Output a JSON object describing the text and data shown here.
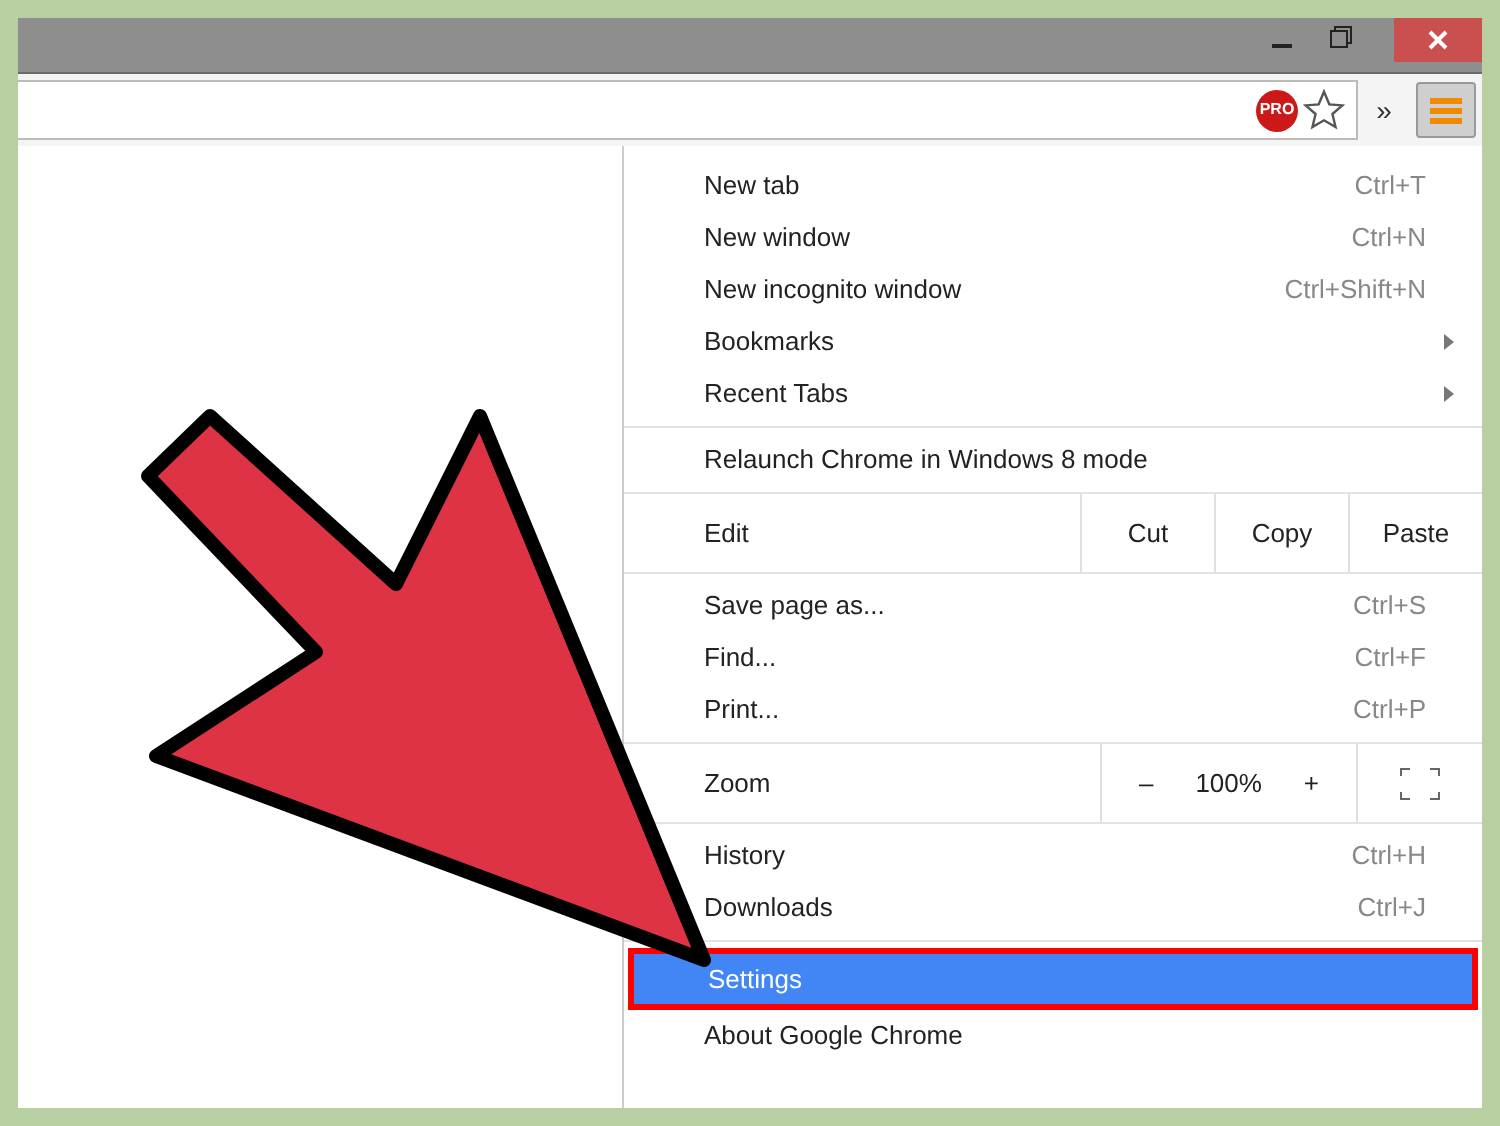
{
  "toolbar": {
    "badge": "PRO",
    "overflow": "»"
  },
  "menu": {
    "sections": [
      {
        "kind": "items",
        "items": [
          {
            "label": "New tab",
            "shortcut": "Ctrl+T",
            "submenu": false,
            "selected": false
          },
          {
            "label": "New window",
            "shortcut": "Ctrl+N",
            "submenu": false,
            "selected": false
          },
          {
            "label": "New incognito window",
            "shortcut": "Ctrl+Shift+N",
            "submenu": false,
            "selected": false
          },
          {
            "label": "Bookmarks",
            "submenu": true,
            "selected": false
          },
          {
            "label": "Recent Tabs",
            "submenu": true,
            "selected": false
          }
        ]
      },
      {
        "kind": "items",
        "items": [
          {
            "label": "Relaunch Chrome in Windows 8 mode",
            "submenu": false,
            "selected": false
          }
        ]
      },
      {
        "kind": "edit",
        "label": "Edit",
        "buttons": [
          "Cut",
          "Copy",
          "Paste"
        ]
      },
      {
        "kind": "items",
        "items": [
          {
            "label": "Save page as...",
            "shortcut": "Ctrl+S",
            "submenu": false,
            "selected": false
          },
          {
            "label": "Find...",
            "shortcut": "Ctrl+F",
            "submenu": false,
            "selected": false
          },
          {
            "label": "Print...",
            "shortcut": "Ctrl+P",
            "submenu": false,
            "selected": false
          }
        ]
      },
      {
        "kind": "zoom",
        "label": "Zoom",
        "minus": "–",
        "value": "100%",
        "plus": "+"
      },
      {
        "kind": "items",
        "items": [
          {
            "label": "History",
            "shortcut": "Ctrl+H",
            "submenu": false,
            "selected": false
          },
          {
            "label": "Downloads",
            "shortcut": "Ctrl+J",
            "submenu": false,
            "selected": false
          }
        ]
      },
      {
        "kind": "items",
        "items": [
          {
            "label": "Settings",
            "submenu": false,
            "selected": true
          },
          {
            "label": "About Google Chrome",
            "submenu": false,
            "selected": false
          }
        ]
      }
    ]
  }
}
